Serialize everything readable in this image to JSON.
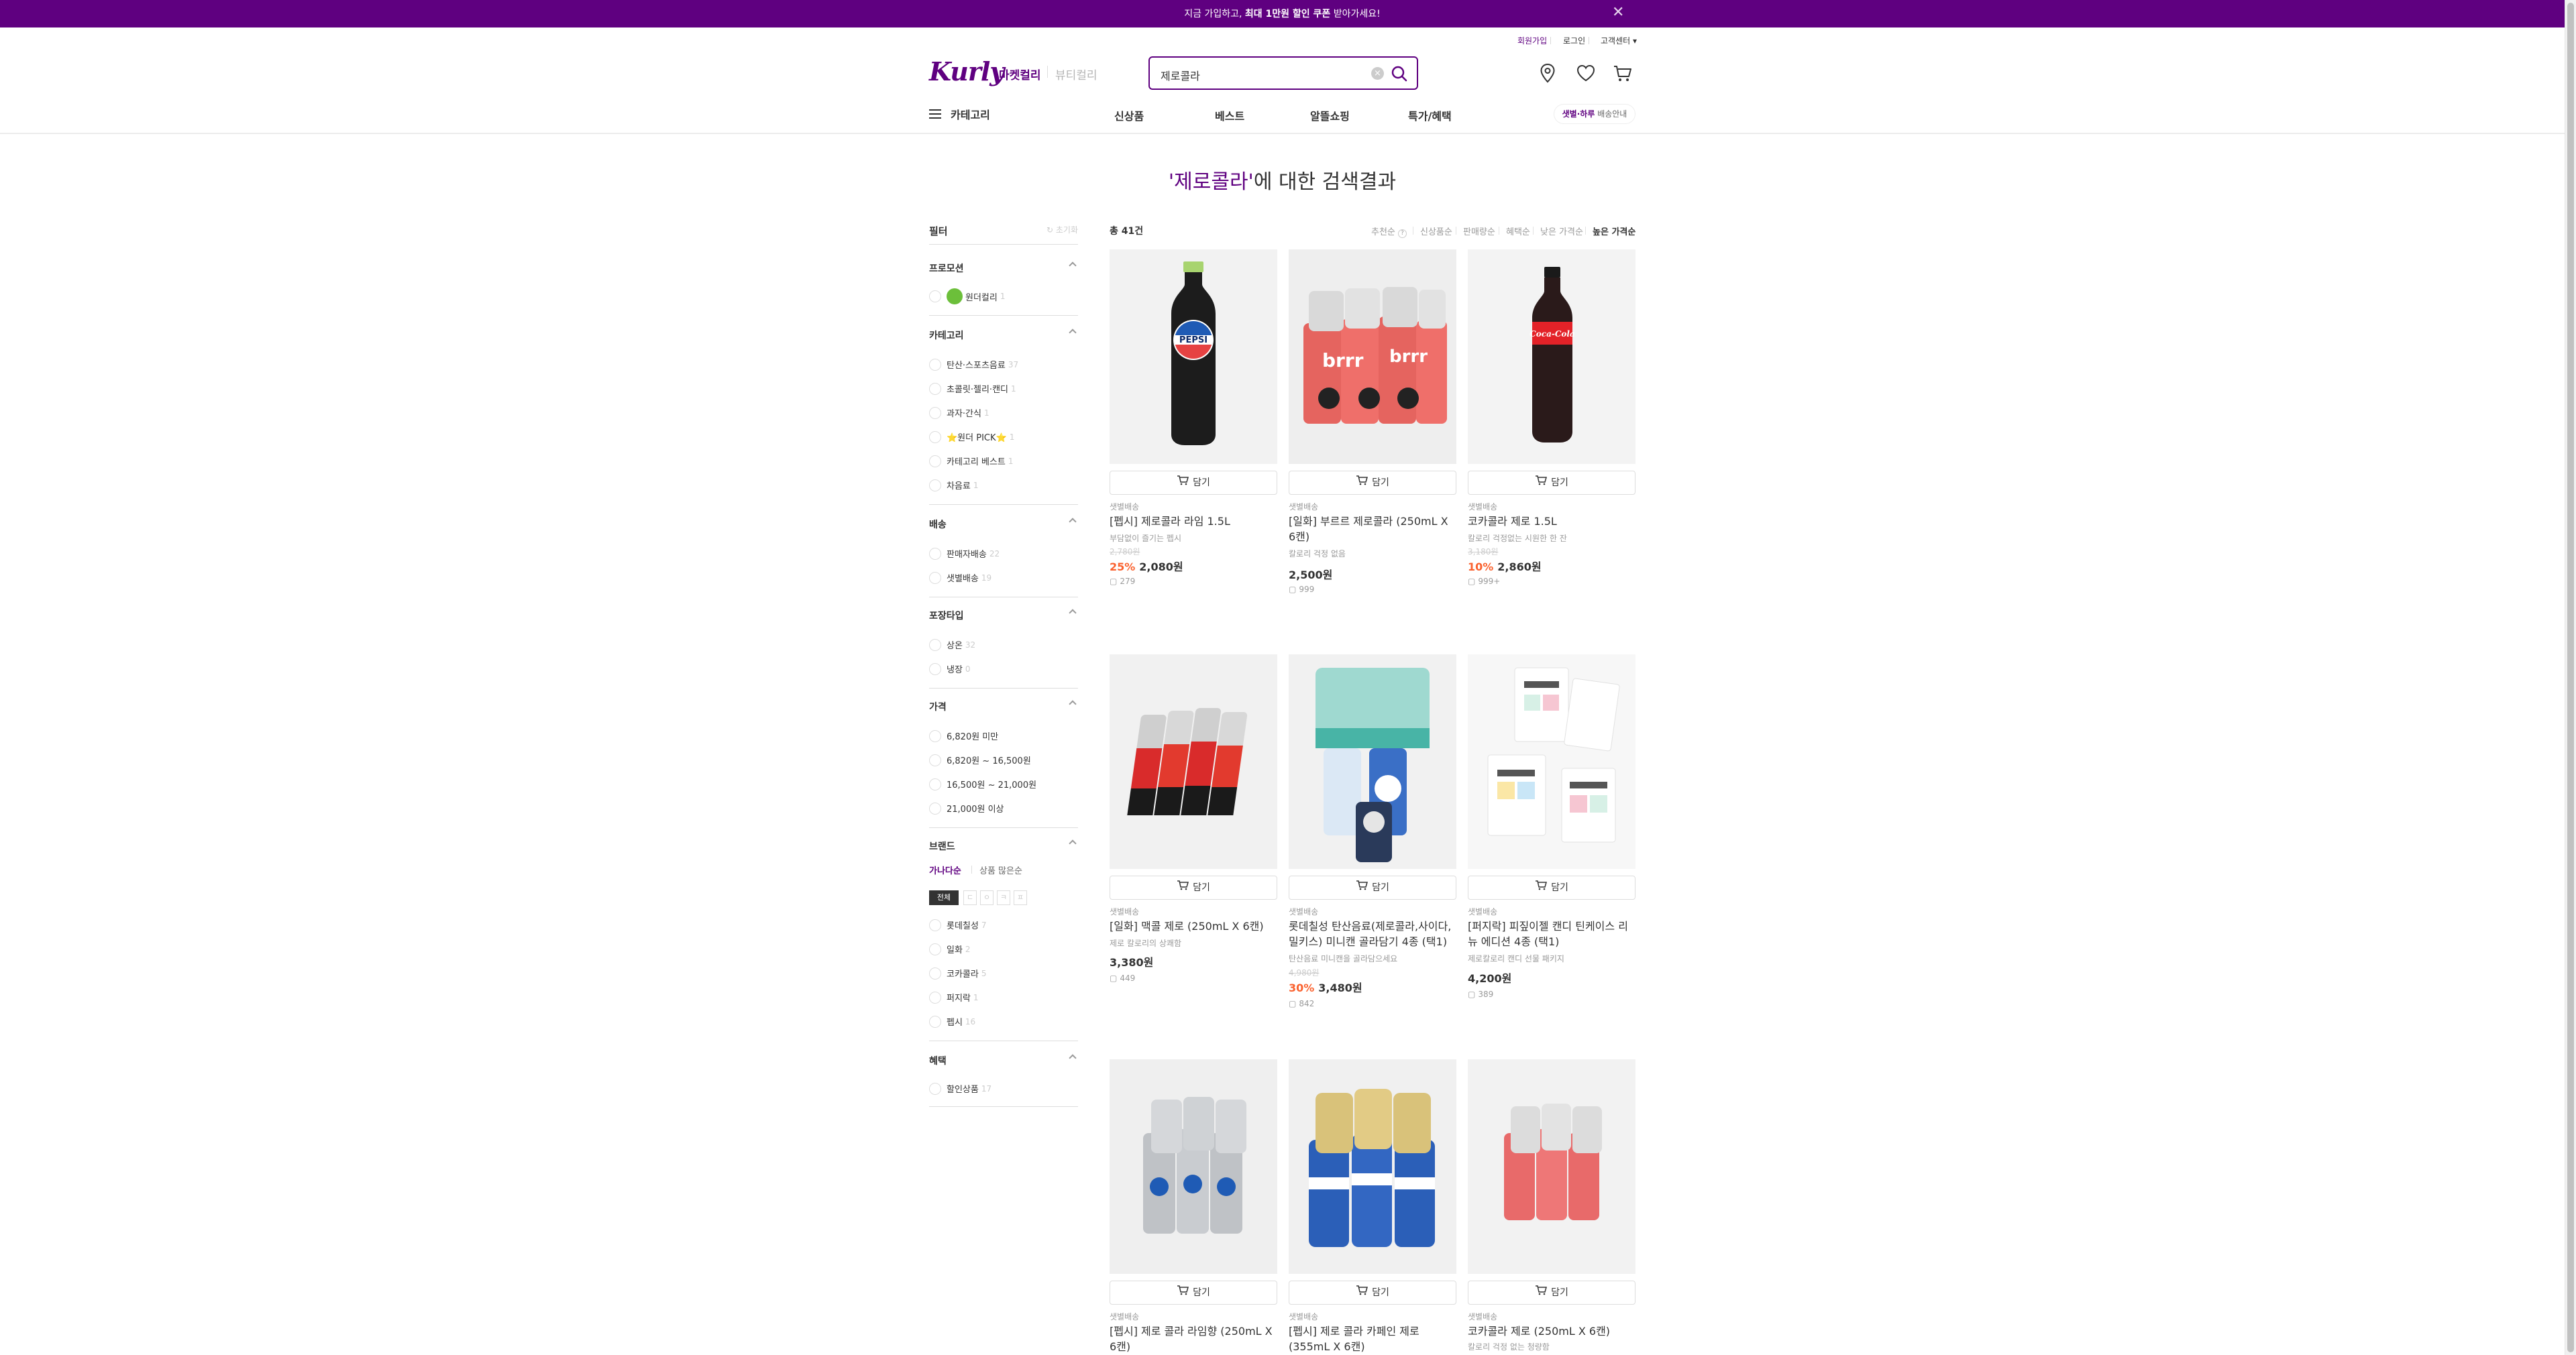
{
  "promo": {
    "text_prefix": "지금 가입하고, ",
    "text_bold": "최대 1만원 할인 쿠폰",
    "text_suffix": " 받아가세요!"
  },
  "util": {
    "signup": "회원가입",
    "login": "로그인",
    "support": "고객센터"
  },
  "header": {
    "logo": "Kurly",
    "store_market": "마켓컬리",
    "store_beauty": "뷰티컬리",
    "search_value": "제로콜라"
  },
  "gnb": {
    "category": "카테고리",
    "items": [
      "신상품",
      "베스트",
      "알뜰쇼핑",
      "특가/혜택"
    ],
    "delivery_bold": "샛별·하루",
    "delivery_rest": " 배송안내"
  },
  "title": {
    "keyword": "'제로콜라'",
    "suffix": "에 대한 검색결과"
  },
  "filter": {
    "title": "필터",
    "reset": "초기화",
    "sections": {
      "promotion": {
        "title": "프로모션",
        "options": [
          {
            "label": "원더컬리",
            "count": "1"
          }
        ]
      },
      "category": {
        "title": "카테고리",
        "options": [
          {
            "label": "탄산·스포츠음료",
            "count": "37"
          },
          {
            "label": "초콜릿·젤리·캔디",
            "count": "1"
          },
          {
            "label": "과자·간식",
            "count": "1"
          },
          {
            "label": "⭐원더 PICK⭐",
            "count": "1"
          },
          {
            "label": "카테고리 베스트",
            "count": "1"
          },
          {
            "label": "차음료",
            "count": "1"
          }
        ]
      },
      "delivery": {
        "title": "배송",
        "options": [
          {
            "label": "판매자배송",
            "count": "22"
          },
          {
            "label": "샛별배송",
            "count": "19"
          }
        ]
      },
      "package": {
        "title": "포장타입",
        "options": [
          {
            "label": "상온",
            "count": "32"
          },
          {
            "label": "냉장",
            "count": "0"
          }
        ]
      },
      "price": {
        "title": "가격",
        "options": [
          {
            "label": "6,820원 미만"
          },
          {
            "label": "6,820원 ~ 16,500원"
          },
          {
            "label": "16,500원 ~ 21,000원"
          },
          {
            "label": "21,000원 이상"
          }
        ]
      },
      "brand": {
        "title": "브랜드",
        "sort_abc": "가나다순",
        "sort_count": "상품 많은순",
        "initials": [
          "전체",
          "ㄷ",
          "ㅇ",
          "ㅋ",
          "ㅍ"
        ],
        "options": [
          {
            "label": "롯데칠성",
            "count": "7"
          },
          {
            "label": "일화",
            "count": "2"
          },
          {
            "label": "코카콜라",
            "count": "5"
          },
          {
            "label": "퍼지락",
            "count": "1"
          },
          {
            "label": "펩시",
            "count": "16"
          }
        ]
      },
      "benefit": {
        "title": "혜택",
        "options": [
          {
            "label": "할인상품",
            "count": "17"
          }
        ]
      }
    }
  },
  "list": {
    "total": "총 41건",
    "sorts": [
      "추천순",
      "신상품순",
      "판매량순",
      "혜택순",
      "낮은 가격순",
      "높은 가격순"
    ],
    "active_sort": "높은 가격순",
    "cart_label": "담기",
    "products": [
      {
        "delivery": "샛별배송",
        "name": "[펩시] 제로콜라 라임 1.5L",
        "sub": "부담없이 즐기는 펩시",
        "orig": "2,780원",
        "discount": "25%",
        "price": "2,080원",
        "reviews": "279"
      },
      {
        "delivery": "샛별배송",
        "name": "[일화] 부르르 제로콜라 (250mL X 6캔)",
        "sub": "칼로리 걱정 없음",
        "orig": "",
        "discount": "",
        "price": "2,500원",
        "reviews": "999"
      },
      {
        "delivery": "샛별배송",
        "name": "코카콜라 제로 1.5L",
        "sub": "칼로리 걱정없는 시원한 한 잔",
        "orig": "3,180원",
        "discount": "10%",
        "price": "2,860원",
        "reviews": "999+"
      },
      {
        "delivery": "샛별배송",
        "name": "[일화] 맥콜 제로 (250mL X 6캔)",
        "sub": "제로 칼로리의 상쾌함",
        "orig": "",
        "discount": "",
        "price": "3,380원",
        "reviews": "449"
      },
      {
        "delivery": "샛별배송",
        "name": "롯데칠성 탄산음료(제로콜라,사이다,밀키스) 미니캔 골라담기 4종 (택1)",
        "sub": "탄산음료 미니캔을 골라담으세요",
        "orig": "4,980원",
        "discount": "30%",
        "price": "3,480원",
        "reviews": "842"
      },
      {
        "delivery": "샛별배송",
        "name": "[퍼지락] 피짚이젤 캔디 틴케이스 리뉴 에디션 4종 (택1)",
        "sub": "제로칼로리 캔디 선물 패키지",
        "orig": "",
        "discount": "",
        "price": "4,200원",
        "reviews": "389"
      },
      {
        "delivery": "샛별배송",
        "name": "[펩시] 제로 콜라 라임향 (250mL X 6캔)",
        "sub": "",
        "orig": "",
        "discount": "",
        "price": "",
        "reviews": ""
      },
      {
        "delivery": "샛별배송",
        "name": "[펩시] 제로 콜라 카페인 제로 (355mL X 6캔)",
        "sub": "",
        "orig": "",
        "discount": "",
        "price": "",
        "reviews": ""
      },
      {
        "delivery": "샛별배송",
        "name": "코카콜라 제로 (250mL X 6캔)",
        "sub": "칼로리 걱정 없는 청량함",
        "orig": "",
        "discount": "",
        "price": "",
        "reviews": ""
      }
    ]
  },
  "colors": {
    "brand": "#5f0080",
    "discount": "#fa622f"
  }
}
